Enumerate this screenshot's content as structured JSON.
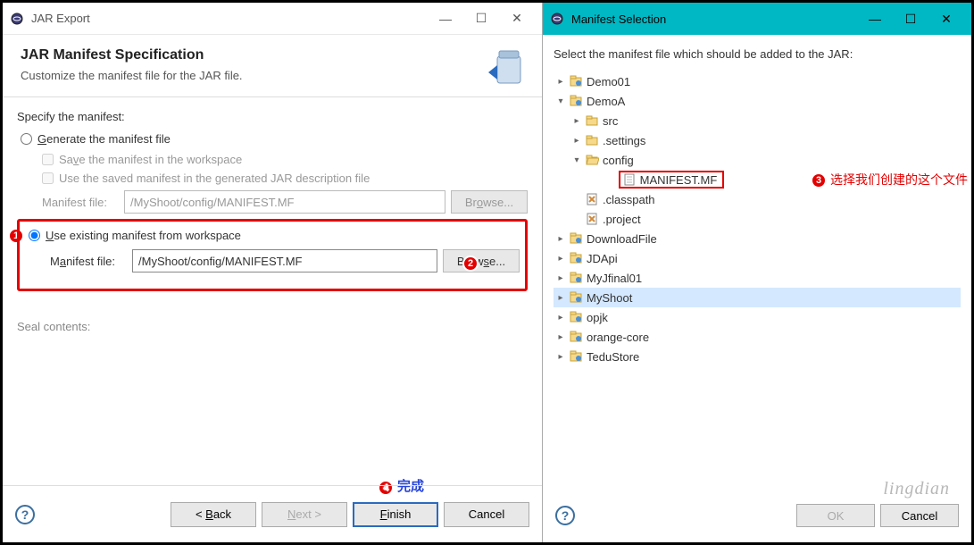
{
  "left": {
    "title": "JAR Export",
    "header_title": "JAR Manifest Specification",
    "header_sub": "Customize the manifest file for the JAR file.",
    "specify_label": "Specify the manifest:",
    "generate_label": "Generate the manifest file",
    "save_label": "Save the manifest in the workspace",
    "use_saved_label": "Use the saved manifest in the generated JAR description file",
    "manifest_file_label": "Manifest file:",
    "manifest_file_value_disabled": "/MyShoot/config/MANIFEST.MF",
    "browse_label": "Browse...",
    "use_existing_label": "Use existing manifest from workspace",
    "manifest_file_label2": "Manifest file:",
    "manifest_file_value": "/MyShoot/config/MANIFEST.MF",
    "browse_label2": "Browse...",
    "seal_label": "Seal contents:",
    "back_label": "< Back",
    "next_label": "Next >",
    "finish_label": "Finish",
    "cancel_label": "Cancel"
  },
  "right": {
    "title": "Manifest Selection",
    "instruction": "Select the manifest file which should be added to the JAR:",
    "tree": [
      {
        "indent": 0,
        "arrow": "▸",
        "icon": "project",
        "label": "Demo01"
      },
      {
        "indent": 0,
        "arrow": "▾",
        "icon": "project",
        "label": "DemoA"
      },
      {
        "indent": 1,
        "arrow": "▸",
        "icon": "folder",
        "label": "src"
      },
      {
        "indent": 1,
        "arrow": "▸",
        "icon": "folder",
        "label": ".settings"
      },
      {
        "indent": 1,
        "arrow": "▾",
        "icon": "folder-open",
        "label": "config"
      },
      {
        "indent": 2,
        "arrow": "",
        "icon": "file",
        "label": "MANIFEST.MF",
        "highlight": true
      },
      {
        "indent": 1,
        "arrow": "",
        "icon": "xfile",
        "label": ".classpath"
      },
      {
        "indent": 1,
        "arrow": "",
        "icon": "xfile",
        "label": ".project"
      },
      {
        "indent": 0,
        "arrow": "▸",
        "icon": "project",
        "label": "DownloadFile"
      },
      {
        "indent": 0,
        "arrow": "▸",
        "icon": "project",
        "label": "JDApi"
      },
      {
        "indent": 0,
        "arrow": "▸",
        "icon": "project",
        "label": "MyJfinal01"
      },
      {
        "indent": 0,
        "arrow": "▸",
        "icon": "project",
        "label": "MyShoot",
        "selected": true
      },
      {
        "indent": 0,
        "arrow": "▸",
        "icon": "project",
        "label": "opjk"
      },
      {
        "indent": 0,
        "arrow": "▸",
        "icon": "project",
        "label": "orange-core"
      },
      {
        "indent": 0,
        "arrow": "▸",
        "icon": "project",
        "label": "TeduStore"
      }
    ],
    "ok_label": "OK",
    "cancel_label": "Cancel"
  },
  "annotations": {
    "b1": "1",
    "b2": "2",
    "b3": "3",
    "b4": "4",
    "text3": "选择我们创建的这个文件",
    "text4": "完成"
  },
  "watermark": "lingdian"
}
